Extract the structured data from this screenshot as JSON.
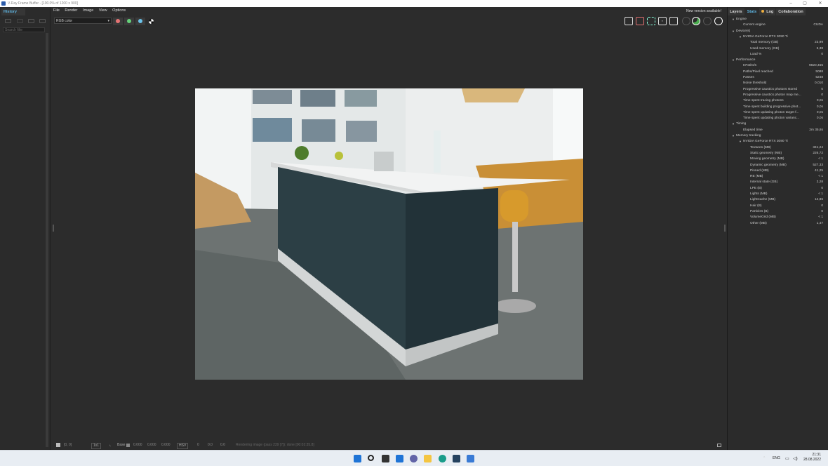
{
  "window": {
    "title": "V-Ray Frame Buffer - [100.0% of 1200 x 900]",
    "min": "–",
    "max": "▢",
    "close": "✕"
  },
  "history": {
    "tab": "History",
    "search_placeholder": "Search filte"
  },
  "menu": [
    "File",
    "Render",
    "Image",
    "View",
    "Options"
  ],
  "toolbar": {
    "channel": "RGB color",
    "channel_arrow": "▾",
    "new_version": "New version available!",
    "icons": [
      "save-icon",
      "clear-icon",
      "region-render-icon",
      "lens-effects-icon",
      "compare-icon",
      "stop-icon",
      "render-teapot-icon",
      "ipr-icon",
      "render-settings-icon"
    ]
  },
  "colors": {
    "red": "#e57373",
    "green": "#66d17a",
    "blue": "#6cc3ea",
    "accent": "#5fb8e6"
  },
  "right_tabs": [
    "Layers",
    "Stats",
    "Log",
    "Collaboration"
  ],
  "stats": [
    {
      "label": "Engine",
      "value": "",
      "level": 0,
      "group": true
    },
    {
      "label": "Current engine",
      "value": "CUDA",
      "level": 1
    },
    {
      "label": "Device(s)",
      "value": "",
      "level": 0,
      "group": true
    },
    {
      "label": "NVIDIA GeForce RTX 3090 Ti",
      "value": "",
      "level": 1,
      "group": true
    },
    {
      "label": "Total memory (GB)",
      "value": "23,99",
      "level": 2
    },
    {
      "label": "Used memory (GB)",
      "value": "5,38",
      "level": 2
    },
    {
      "label": "Load %",
      "value": "0",
      "level": 2
    },
    {
      "label": "Performance",
      "value": "",
      "level": 0,
      "group": true
    },
    {
      "label": "KPaths/s",
      "value": "9820,455",
      "level": 1
    },
    {
      "label": "Paths/Pixel reached",
      "value": "5088",
      "level": 1
    },
    {
      "label": "Passes",
      "value": "5248",
      "level": 1
    },
    {
      "label": "Noise threshold",
      "value": "0.010",
      "level": 1
    },
    {
      "label": "Progressive caustics photons stored",
      "value": "0",
      "level": 1
    },
    {
      "label": "Progressive caustics photon map me...",
      "value": "0",
      "level": 1
    },
    {
      "label": "Time spent tracing photons",
      "value": "0,0s",
      "level": 1
    },
    {
      "label": "Time spent building progressive phot...",
      "value": "0,0s",
      "level": 1
    },
    {
      "label": "Time spent updating photon target f...",
      "value": "0,0s",
      "level": 1
    },
    {
      "label": "Time spent updating photon varianc...",
      "value": "0,0s",
      "level": 1
    },
    {
      "label": "Timing",
      "value": "",
      "level": 0,
      "group": true
    },
    {
      "label": "Elapsed time",
      "value": "2m 35,8s",
      "level": 1
    },
    {
      "label": "Memory tracking",
      "value": "",
      "level": 0,
      "group": true
    },
    {
      "label": "NVIDIA GeForce RTX 3090 Ti",
      "value": "",
      "level": 1,
      "group": true
    },
    {
      "label": "Textures (MB)",
      "value": "341,24",
      "level": 2
    },
    {
      "label": "Static geometry (MB)",
      "value": "226,72",
      "level": 2
    },
    {
      "label": "Moving geometry (MB)",
      "value": "< 1",
      "level": 2
    },
    {
      "label": "Dynamic geometry (MB)",
      "value": "527,33",
      "level": 2
    },
    {
      "label": "Pinned (MB)",
      "value": "41,25",
      "level": 2
    },
    {
      "label": "RE (MB)",
      "value": "< 1",
      "level": 2
    },
    {
      "label": "Internal state (GB)",
      "value": "2,28",
      "level": 2
    },
    {
      "label": "LPE (B)",
      "value": "0",
      "level": 2
    },
    {
      "label": "Lights (MB)",
      "value": "< 1",
      "level": 2
    },
    {
      "label": "LightCache (MB)",
      "value": "12,86",
      "level": 2
    },
    {
      "label": "Hair (B)",
      "value": "0",
      "level": 2
    },
    {
      "label": "Particles (B)",
      "value": "0",
      "level": 2
    },
    {
      "label": "VolumeGrid (MB)",
      "value": "< 1",
      "level": 2
    },
    {
      "label": "Other (MB)",
      "value": "1,47",
      "level": 2
    }
  ],
  "statusbar": {
    "coords": "[0, 0]",
    "zoom": "1x1",
    "base_label": "Base",
    "r": "0.000",
    "g": "0.000",
    "b": "0.000",
    "mode": "HSV",
    "h": "0",
    "s": "0.0",
    "v": "0.0",
    "status": "Rendering image (pass 239 [7]): done [00:02:35.8]"
  },
  "taskbar": {
    "lang": "ENG",
    "time": "21:31",
    "date": "28.08.2022",
    "chevron": "^"
  }
}
